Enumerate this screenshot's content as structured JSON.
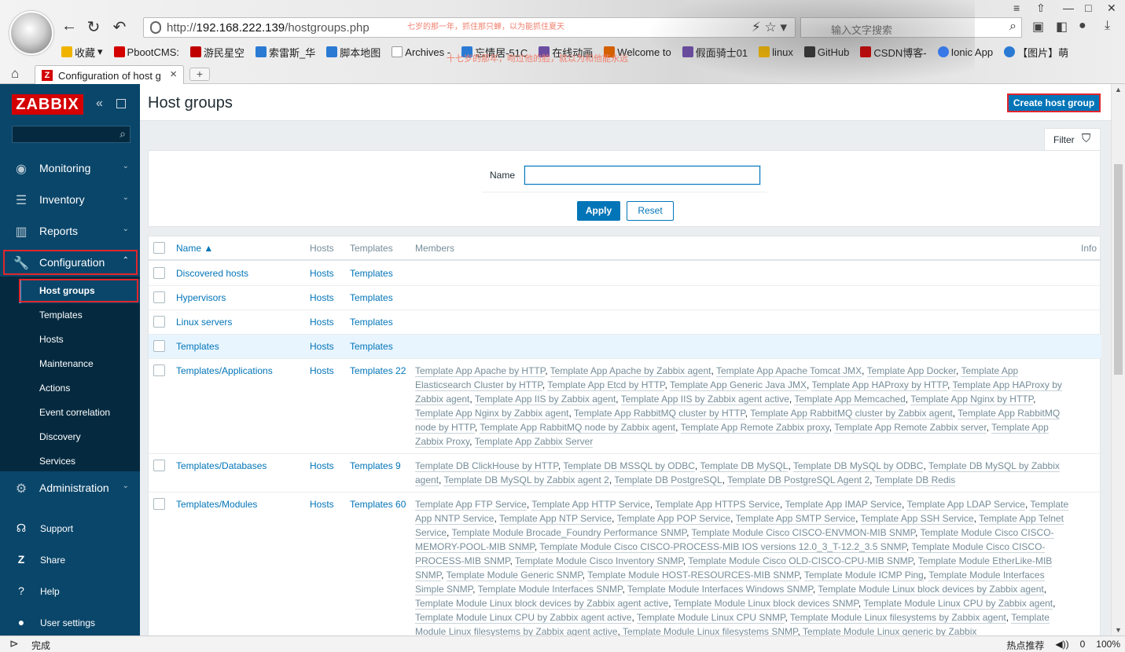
{
  "browser": {
    "url_prefix": "http://",
    "url_host": "192.168.222.139",
    "url_path": "/hostgroups.php",
    "overlay_text_1": "七岁的那一年，抓住那只蝉，以为能抓住夏天",
    "overlay_text_2": "十七岁的那年，吻过他的脸，就以为和他能永远",
    "search_placeholder": "输入文字搜索",
    "tab_title": "Configuration of host g",
    "new_tab": "+",
    "status_text": "完成",
    "status_right": [
      "热点推荐",
      "0",
      "100%"
    ],
    "bookmarks": [
      {
        "label": "收藏",
        "color": "#f0b400"
      },
      {
        "label": "PbootCMS:",
        "color": "#d40000"
      },
      {
        "label": "游民星空",
        "color": "#c00000"
      },
      {
        "label": "索雷斯_华",
        "color": "#2a7ad4"
      },
      {
        "label": "脚本地图",
        "color": "#2a7ad4"
      },
      {
        "label": "Archives -",
        "color": "#999999"
      },
      {
        "label": "忘情居-51C",
        "color": "#2a7ad4"
      },
      {
        "label": "在线动画",
        "color": "#6a4ca0"
      },
      {
        "label": "Welcome to",
        "color": "#d46000"
      },
      {
        "label": "假面骑士01",
        "color": "#6a4ca0"
      },
      {
        "label": "linux",
        "color": "#f0b400"
      },
      {
        "label": "GitHub",
        "color": "#333333"
      },
      {
        "label": "CSDN博客-",
        "color": "#d40000"
      },
      {
        "label": "Ionic App",
        "color": "#3880ff"
      },
      {
        "label": "【图片】萌",
        "color": "#2a7ad4"
      }
    ]
  },
  "sidebar": {
    "logo": "ZABBIX",
    "menu": [
      {
        "label": "Monitoring",
        "icon": "eye-icon"
      },
      {
        "label": "Inventory",
        "icon": "list-icon"
      },
      {
        "label": "Reports",
        "icon": "bar-chart-icon"
      },
      {
        "label": "Configuration",
        "icon": "wrench-icon"
      }
    ],
    "submenu": [
      "Host groups",
      "Templates",
      "Hosts",
      "Maintenance",
      "Actions",
      "Event correlation",
      "Discovery",
      "Services"
    ],
    "administration": "Administration",
    "footer": [
      {
        "label": "Support",
        "icon": "headset-icon"
      },
      {
        "label": "Share",
        "icon": "share-icon"
      },
      {
        "label": "Help",
        "icon": "help-icon"
      },
      {
        "label": "User settings",
        "icon": "user-icon"
      }
    ]
  },
  "page": {
    "title": "Host groups",
    "create_button": "Create host group",
    "filter_label": "Filter",
    "name_label": "Name",
    "name_value": "",
    "apply": "Apply",
    "reset": "Reset"
  },
  "table": {
    "headers": {
      "name": "Name ▲",
      "hosts": "Hosts",
      "templates": "Templates",
      "members": "Members",
      "info": "Info"
    },
    "rows": [
      {
        "name": "Discovered hosts",
        "hosts": "Hosts",
        "templates": "Templates",
        "members": []
      },
      {
        "name": "Hypervisors",
        "hosts": "Hosts",
        "templates": "Templates",
        "members": []
      },
      {
        "name": "Linux servers",
        "hosts": "Hosts",
        "templates": "Templates",
        "members": []
      },
      {
        "name": "Templates",
        "hosts": "Hosts",
        "templates": "Templates",
        "members": []
      },
      {
        "name": "Templates/Applications",
        "hosts": "Hosts",
        "templates": "Templates 22",
        "members": [
          "Template App Apache by HTTP",
          "Template App Apache by Zabbix agent",
          "Template App Apache Tomcat JMX",
          "Template App Docker",
          "Template App Elasticsearch Cluster by HTTP",
          "Template App Etcd by HTTP",
          "Template App Generic Java JMX",
          "Template App HAProxy by HTTP",
          "Template App HAProxy by Zabbix agent",
          "Template App IIS by Zabbix agent",
          "Template App IIS by Zabbix agent active",
          "Template App Memcached",
          "Template App Nginx by HTTP",
          "Template App Nginx by Zabbix agent",
          "Template App RabbitMQ cluster by HTTP",
          "Template App RabbitMQ cluster by Zabbix agent",
          "Template App RabbitMQ node by HTTP",
          "Template App RabbitMQ node by Zabbix agent",
          "Template App Remote Zabbix proxy",
          "Template App Remote Zabbix server",
          "Template App Zabbix Proxy",
          "Template App Zabbix Server"
        ]
      },
      {
        "name": "Templates/Databases",
        "hosts": "Hosts",
        "templates": "Templates 9",
        "members": [
          "Template DB ClickHouse by HTTP",
          "Template DB MSSQL by ODBC",
          "Template DB MySQL",
          "Template DB MySQL by ODBC",
          "Template DB MySQL by Zabbix agent",
          "Template DB MySQL by Zabbix agent 2",
          "Template DB PostgreSQL",
          "Template DB PostgreSQL Agent 2",
          "Template DB Redis"
        ]
      },
      {
        "name": "Templates/Modules",
        "hosts": "Hosts",
        "templates": "Templates 60",
        "members": [
          "Template App FTP Service",
          "Template App HTTP Service",
          "Template App HTTPS Service",
          "Template App IMAP Service",
          "Template App LDAP Service",
          "Template App NNTP Service",
          "Template App NTP Service",
          "Template App POP Service",
          "Template App SMTP Service",
          "Template App SSH Service",
          "Template App Telnet Service",
          "Template Module Brocade_Foundry Performance SNMP",
          "Template Module Cisco CISCO-ENVMON-MIB SNMP",
          "Template Module Cisco CISCO-MEMORY-POOL-MIB SNMP",
          "Template Module Cisco CISCO-PROCESS-MIB IOS versions 12.0_3_T-12.2_3.5 SNMP",
          "Template Module Cisco CISCO-PROCESS-MIB SNMP",
          "Template Module Cisco Inventory SNMP",
          "Template Module Cisco OLD-CISCO-CPU-MIB SNMP",
          "Template Module EtherLike-MIB SNMP",
          "Template Module Generic SNMP",
          "Template Module HOST-RESOURCES-MIB SNMP",
          "Template Module ICMP Ping",
          "Template Module Interfaces Simple SNMP",
          "Template Module Interfaces SNMP",
          "Template Module Interfaces Windows SNMP",
          "Template Module Linux block devices by Zabbix agent",
          "Template Module Linux block devices by Zabbix agent active",
          "Template Module Linux block devices SNMP",
          "Template Module Linux CPU by Zabbix agent",
          "Template Module Linux CPU by Zabbix agent active",
          "Template Module Linux CPU SNMP",
          "Template Module Linux filesystems by Zabbix agent",
          "Template Module Linux filesystems by Zabbix agent active",
          "Template Module Linux filesystems SNMP",
          "Template Module Linux generic by Zabbix"
        ]
      }
    ]
  }
}
